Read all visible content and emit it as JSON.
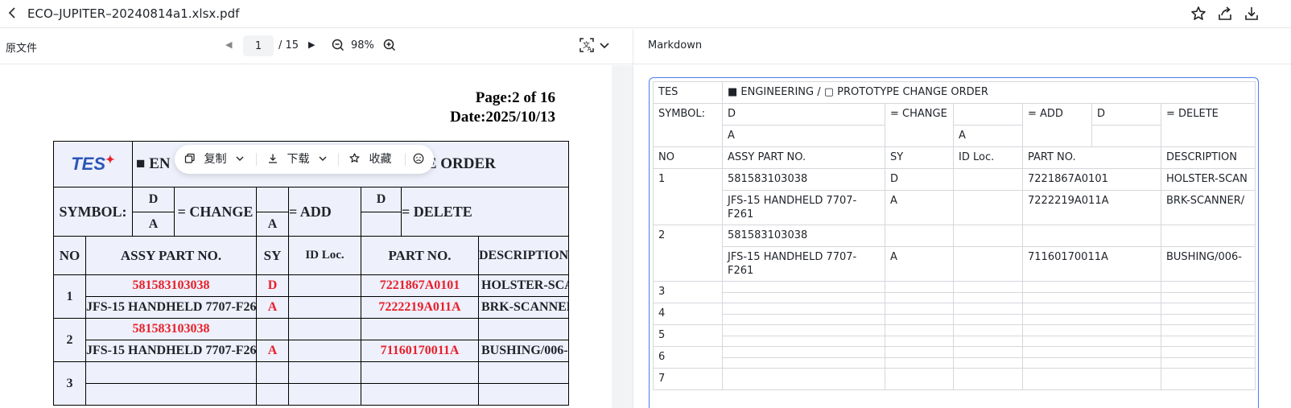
{
  "topbar": {
    "title": "ECO–JUPITER–20240814a1.xlsx.pdf",
    "icons": [
      "chevron-left-icon",
      "star-icon",
      "share-icon",
      "download-icon"
    ]
  },
  "toolbar": {
    "left_label": "原文件",
    "page_current": "1",
    "page_total": "/ 15",
    "zoom": "98%",
    "right_label": "Markdown"
  },
  "pdf": {
    "page_line": "Page:2 of 16",
    "date_line": "Date:2025/10/13",
    "logo": "TES",
    "title_prefix": "■ EN",
    "title_suffix": "ANGE ORDER",
    "symbol_label": "SYMBOL:",
    "sym_d": "D",
    "sym_a": "A",
    "change": "= CHANGE",
    "add": "= ADD",
    "delete": "= DELETE",
    "headers": [
      "NO",
      "ASSY PART NO.",
      "SY",
      "ID Loc.",
      "PART NO.",
      "DESCRIPTION"
    ],
    "rows": [
      {
        "no": "1",
        "assy": "581583103038",
        "sy": "D",
        "part": "7221867A0101",
        "desc": "HOLSTER-SCANN"
      },
      {
        "no": "",
        "assy": "JFS-15 HANDHELD 7707-F261",
        "sy": "A",
        "part": "7222219A011A",
        "desc": "BRK-SCANNER/"
      },
      {
        "no": "2",
        "assy": "581583103038",
        "sy": "",
        "part": "",
        "desc": ""
      },
      {
        "no": "",
        "assy": "JFS-15 HANDHELD 7707-F261",
        "sy": "A",
        "part": "71160170011A",
        "desc": "BUSHING/006-"
      },
      {
        "no": "3"
      }
    ]
  },
  "float_toolbar": {
    "copy": "复制",
    "download": "下载",
    "favorite": "收藏"
  },
  "markdown": {
    "tes": "TES",
    "title": "■ ENGINEERING / ▢ PROTOTYPE CHANGE ORDER",
    "symbol": "SYMBOL:",
    "d": "D",
    "a": "A",
    "change": "= CHANGE",
    "add": "= ADD",
    "delete": "= DELETE",
    "headers": [
      "NO",
      "ASSY PART NO.",
      "SY",
      "ID Loc.",
      "PART NO.",
      "DESCRIPTION"
    ],
    "r1a": {
      "no": "1",
      "assy": "581583103038",
      "sy": "D",
      "id": "",
      "part": "7221867A0101",
      "desc": "HOLSTER-SCAN"
    },
    "r1b": {
      "assy": "JFS-15 HANDHELD 7707-F261",
      "sy": "A",
      "id": "",
      "part": "7222219A011A",
      "desc": "BRK-SCANNER/"
    },
    "r2a": {
      "no": "2",
      "assy": "581583103038"
    },
    "r2b": {
      "assy": "JFS-15 HANDHELD 7707-F261",
      "sy": "A",
      "part": "71160170011A",
      "desc": "BUSHING/006-"
    },
    "empty_rows": [
      "3",
      "4",
      "5",
      "6",
      "7"
    ]
  }
}
